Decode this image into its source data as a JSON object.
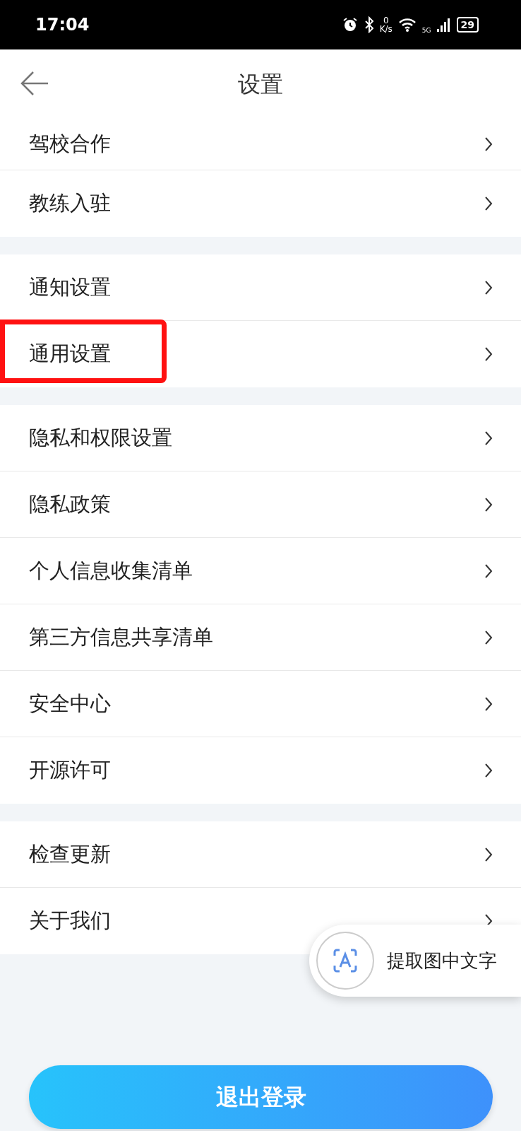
{
  "status_bar": {
    "time": "17:04",
    "speed_value": "0",
    "speed_unit": "K/s",
    "network": "5G",
    "battery": "29"
  },
  "header": {
    "title": "设置"
  },
  "groups": [
    {
      "items": [
        {
          "label": "驾校合作",
          "highlighted": false
        },
        {
          "label": "教练入驻",
          "highlighted": false
        }
      ]
    },
    {
      "items": [
        {
          "label": "通知设置",
          "highlighted": false
        },
        {
          "label": "通用设置",
          "highlighted": true
        }
      ]
    },
    {
      "items": [
        {
          "label": "隐私和权限设置",
          "highlighted": false
        },
        {
          "label": "隐私政策",
          "highlighted": false
        },
        {
          "label": "个人信息收集清单",
          "highlighted": false
        },
        {
          "label": "第三方信息共享清单",
          "highlighted": false
        },
        {
          "label": "安全中心",
          "highlighted": false
        },
        {
          "label": "开源许可",
          "highlighted": false
        }
      ]
    },
    {
      "items": [
        {
          "label": "检查更新",
          "highlighted": false
        },
        {
          "label": "关于我们",
          "highlighted": false
        }
      ]
    }
  ],
  "floating_tool": {
    "label": "提取图中文字"
  },
  "logout_button": {
    "label": "退出登录"
  }
}
